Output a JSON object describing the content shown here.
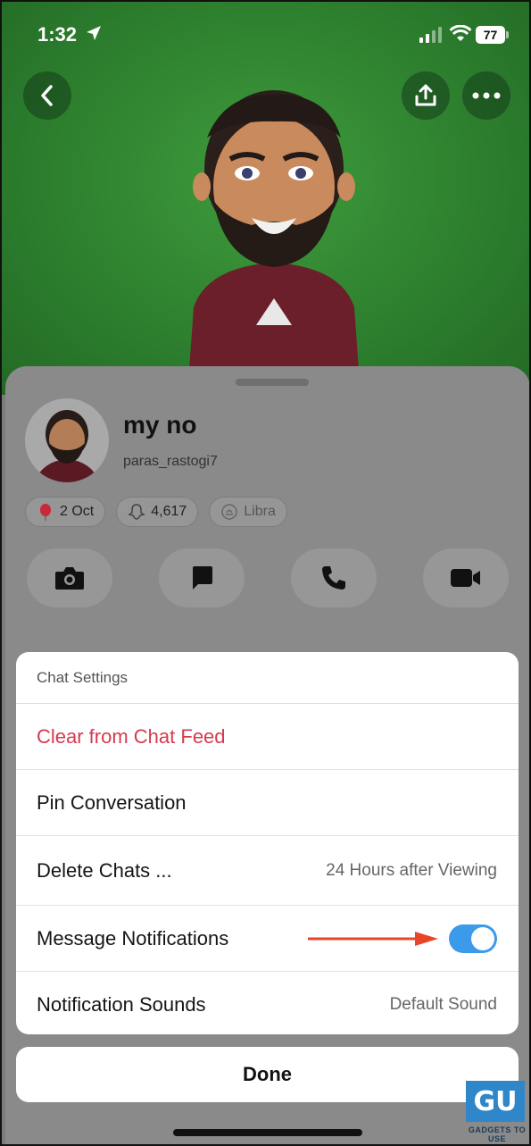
{
  "status_bar": {
    "time": "1:32",
    "battery": "77"
  },
  "profile": {
    "name": "my no",
    "username": "paras_rastogi7",
    "chips": [
      {
        "label": "2 Oct",
        "icon": "balloon-icon"
      },
      {
        "label": "4,617",
        "icon": "snap-score-icon"
      },
      {
        "label": "Libra",
        "icon": "zodiac-icon"
      }
    ],
    "actions": [
      "camera-icon",
      "chat-icon",
      "phone-icon",
      "video-icon"
    ]
  },
  "chat_settings": {
    "header": "Chat Settings",
    "clear": "Clear from Chat Feed",
    "pin": "Pin Conversation",
    "delete_label": "Delete Chats ...",
    "delete_value": "24 Hours after Viewing",
    "notifications_label": "Message Notifications",
    "notifications_on": true,
    "sounds_label": "Notification Sounds",
    "sounds_value": "Default Sound"
  },
  "done_label": "Done",
  "watermark": {
    "logo": "GU",
    "text": "GADGETS TO USE"
  },
  "colors": {
    "accent_toggle": "#3b9aea",
    "danger": "#d63a4e",
    "arrow": "#e8452a",
    "hero_green": "#2f8330"
  }
}
